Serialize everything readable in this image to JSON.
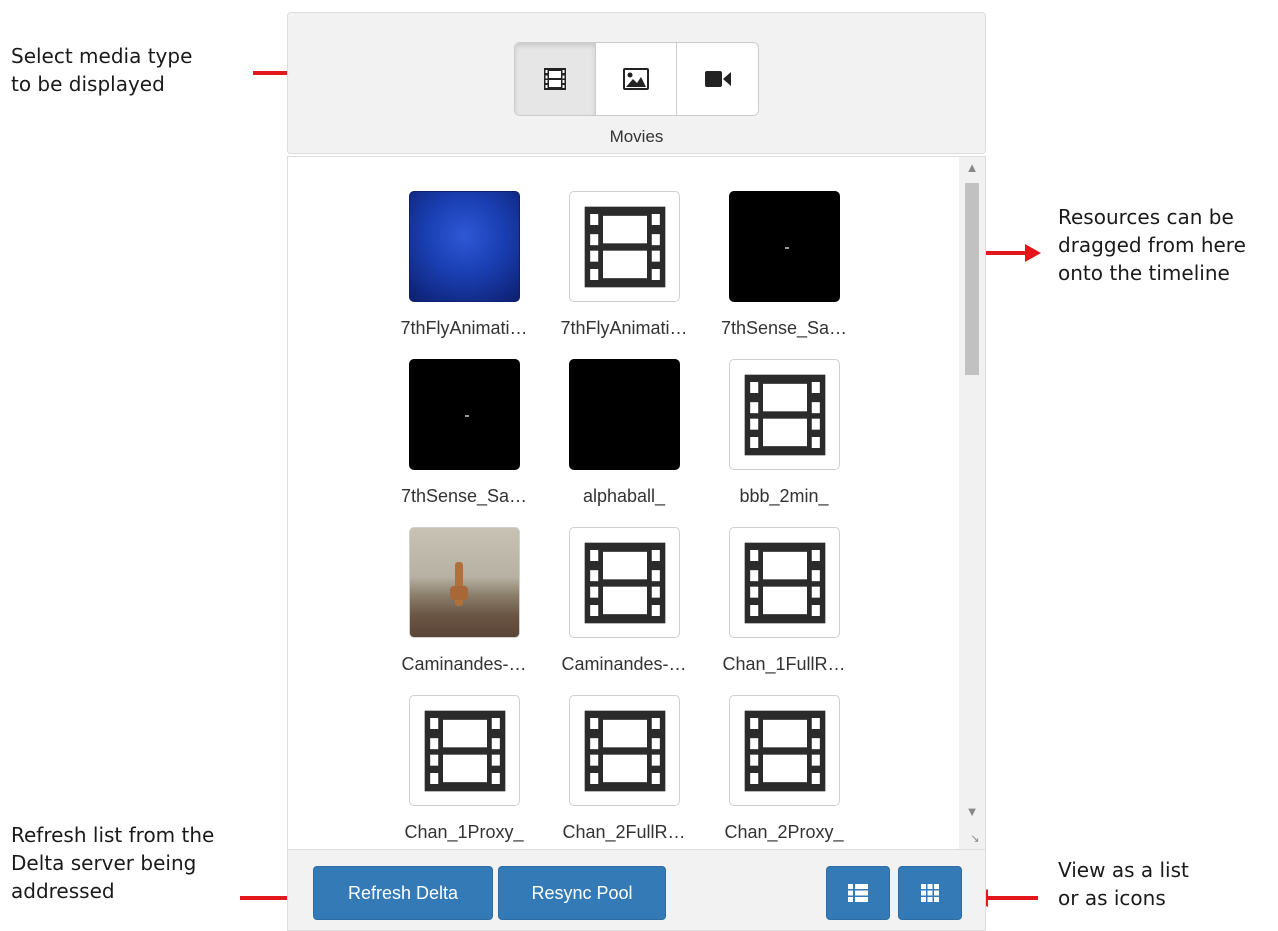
{
  "annotations": {
    "select_media": "Select media type\nto be displayed",
    "resources_drag": "Resources can be\ndragged from here\nonto the timeline",
    "refresh_list": "Refresh list from the\nDelta server being\naddressed",
    "view_as": "View as a list\nor as icons"
  },
  "media_type": {
    "options": [
      {
        "name": "movies",
        "icon": "film-icon"
      },
      {
        "name": "images",
        "icon": "image-icon"
      },
      {
        "name": "video",
        "icon": "video-camera-icon"
      }
    ],
    "selected_label": "Movies"
  },
  "resources": [
    {
      "name": "7thFlyAnimati…",
      "thumb": "blue"
    },
    {
      "name": "7thFlyAnimati…",
      "thumb": "film"
    },
    {
      "name": "7thSense_Sa…",
      "thumb": "black-dot"
    },
    {
      "name": "7thSense_Sa…",
      "thumb": "black-dot"
    },
    {
      "name": "alphaball_",
      "thumb": "black"
    },
    {
      "name": "bbb_2min_",
      "thumb": "film"
    },
    {
      "name": "Caminandes-…",
      "thumb": "llama"
    },
    {
      "name": "Caminandes-…",
      "thumb": "film"
    },
    {
      "name": "Chan_1FullR…",
      "thumb": "film"
    },
    {
      "name": "Chan_1Proxy_",
      "thumb": "film"
    },
    {
      "name": "Chan_2FullR…",
      "thumb": "film"
    },
    {
      "name": "Chan_2Proxy_",
      "thumb": "film"
    }
  ],
  "buttons": {
    "refresh_delta": "Refresh Delta",
    "resync_pool": "Resync Pool",
    "list_view_icon": "list-view-icon",
    "icon_view_icon": "grid-view-icon"
  },
  "colors": {
    "accent": "#337ab7",
    "annotation_arrow": "#e3161b"
  }
}
